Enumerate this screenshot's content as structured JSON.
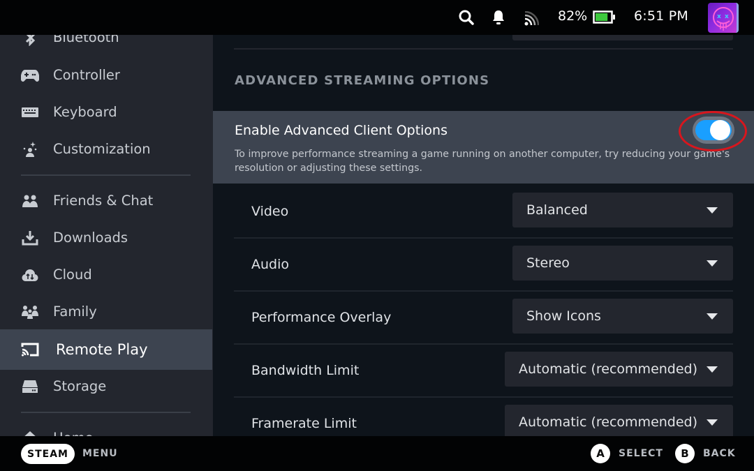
{
  "status_bar": {
    "battery_percent": "82%",
    "battery_level": 0.82,
    "time": "6:51 PM",
    "icons": [
      "search-icon",
      "notification-bell-icon",
      "network-signal-icon",
      "battery-icon",
      "user-avatar"
    ],
    "battery_color": "#3ec93e"
  },
  "sidebar": {
    "items": [
      {
        "label": "Bluetooth",
        "icon": "bluetooth-icon"
      },
      {
        "label": "Controller",
        "icon": "gamepad-icon"
      },
      {
        "label": "Keyboard",
        "icon": "keyboard-icon"
      },
      {
        "label": "Customization",
        "icon": "customization-sparkle-icon"
      },
      {
        "label": "Friends & Chat",
        "icon": "friends-icon"
      },
      {
        "label": "Downloads",
        "icon": "download-icon"
      },
      {
        "label": "Cloud",
        "icon": "cloud-sync-icon"
      },
      {
        "label": "Family",
        "icon": "family-icon"
      },
      {
        "label": "Remote Play",
        "icon": "cast-icon",
        "active": true
      },
      {
        "label": "Storage",
        "icon": "storage-drive-icon"
      },
      {
        "label": "Home",
        "icon": "home-icon"
      }
    ]
  },
  "main": {
    "section_title": "ADVANCED STREAMING OPTIONS",
    "advanced_toggle": {
      "label": "Enable Advanced Client Options",
      "description": "To improve performance streaming a game running on another computer, try reducing your game's resolution or adjusting these settings.",
      "enabled": true,
      "accent_color": "#1a9fff",
      "highlight_color": "#d8161d"
    },
    "settings": [
      {
        "label": "Video",
        "value": "Balanced"
      },
      {
        "label": "Audio",
        "value": "Stereo"
      },
      {
        "label": "Performance Overlay",
        "value": "Show Icons"
      },
      {
        "label": "Bandwidth Limit",
        "value": "Automatic (recommended)"
      },
      {
        "label": "Framerate Limit",
        "value": "Automatic (recommended)"
      }
    ]
  },
  "footer": {
    "steam_button": "STEAM",
    "menu_label": "MENU",
    "a_glyph": "A",
    "select_label": "SELECT",
    "b_glyph": "B",
    "back_label": "BACK"
  }
}
